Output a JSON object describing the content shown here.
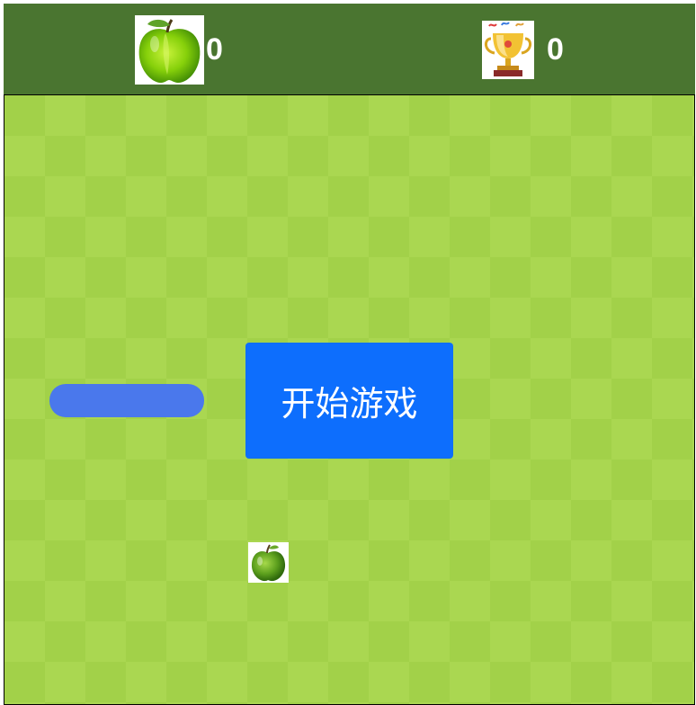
{
  "header": {
    "apple_score": "0",
    "high_score": "0",
    "apple_icon": "green-apple-icon",
    "trophy_icon": "trophy-icon"
  },
  "board": {
    "start_button_label": "开始游戏",
    "food_icon": "apple-food-icon"
  },
  "colors": {
    "header_bg": "#4a7530",
    "board_light": "#aad751",
    "board_dark": "#a2d149",
    "snake": "#4a78ec",
    "start_button": "#0d6efd"
  }
}
